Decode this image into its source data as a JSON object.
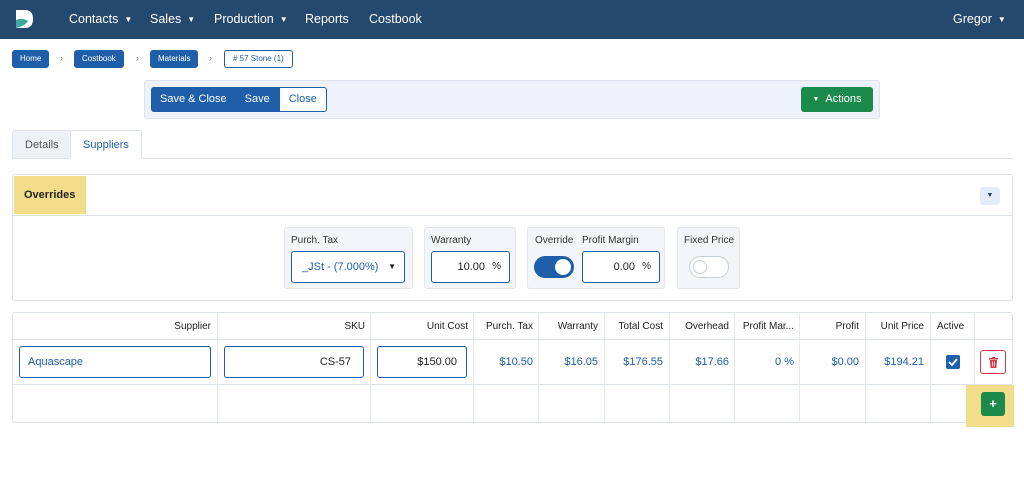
{
  "nav": {
    "items": [
      {
        "label": "Contacts",
        "caret": true
      },
      {
        "label": "Sales",
        "caret": true
      },
      {
        "label": "Production",
        "caret": true
      },
      {
        "label": "Reports",
        "caret": false
      },
      {
        "label": "Costbook",
        "caret": false
      }
    ],
    "user": "Gregor"
  },
  "breadcrumb": [
    "Home",
    "Costbook",
    "Materials",
    "# 57 Stone (1)"
  ],
  "toolbar": {
    "save_close": "Save & Close",
    "save": "Save",
    "close": "Close",
    "actions": "Actions"
  },
  "tabs": {
    "details": "Details",
    "suppliers": "Suppliers"
  },
  "overrides": {
    "title": "Overrides",
    "purch_tax_label": "Purch. Tax",
    "purch_tax_value": "_JSt - (7.000%)",
    "warranty_label": "Warranty",
    "warranty_value": "10.00",
    "override_label": "Override",
    "override_on": true,
    "profit_margin_label": "Profit Margin",
    "profit_margin_value": "0.00",
    "percent": "%",
    "fixed_price_label": "Fixed Price",
    "fixed_price_on": false
  },
  "table": {
    "headers": [
      "Supplier",
      "SKU",
      "Unit Cost",
      "Purch. Tax",
      "Warranty",
      "Total Cost",
      "Overhead",
      "Profit Mar...",
      "Profit",
      "Unit Price",
      "Active"
    ],
    "row": {
      "supplier": "Aquascape",
      "sku": "CS-57",
      "unit_cost": "$150.00",
      "purch_tax": "$10.50",
      "warranty": "$16.05",
      "total_cost": "$176.55",
      "overhead": "$17.66",
      "profit_margin": "0 %",
      "profit": "$0.00",
      "unit_price": "$194.21",
      "active": true
    }
  },
  "colors": {
    "navbar": "#25496e",
    "primary": "#1f5ea8",
    "success": "#1c8a4a",
    "danger": "#dc3545",
    "highlight": "#f2dd8a"
  },
  "icons": {
    "logo": "logo-icon",
    "delete": "trash-icon",
    "add": "plus-icon",
    "check": "check-icon"
  }
}
